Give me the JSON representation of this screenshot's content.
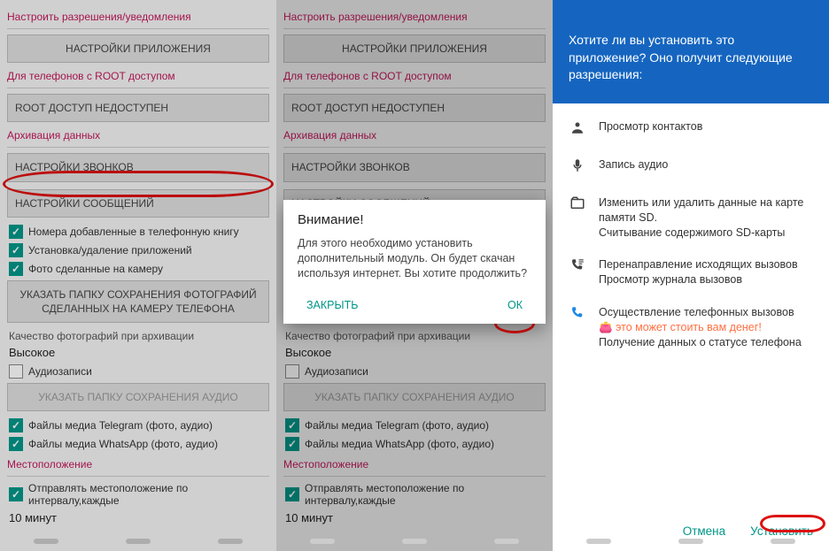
{
  "left": {
    "section_perm": "Настроить разрешения/уведомления",
    "btn_app_settings": "НАСТРОЙКИ ПРИЛОЖЕНИЯ",
    "section_root": "Для телефонов с ROOT доступом",
    "btn_root": "ROOT ДОСТУП НЕДОСТУПЕН",
    "section_archive": "Архивация данных",
    "btn_calls": "НАСТРОЙКИ ЗВОНКОВ",
    "btn_messages": "НАСТРОЙКИ СООБЩЕНИЙ",
    "check_contacts": "Номера добавленные в телефонную книгу",
    "check_apps": "Установка/удаление приложений",
    "check_photos": "Фото сделанные на камеру",
    "btn_photo_folder": "УКАЗАТЬ ПАПКУ СОХРАНЕНИЯ ФОТОГРАФИЙ СДЕЛАННЫХ НА КАМЕРУ ТЕЛЕФОНА",
    "label_quality": "Качество фотографий при архивации",
    "value_quality": "Высокое",
    "check_audio": "Аудиозаписи",
    "btn_audio_folder": "УКАЗАТЬ ПАПКУ СОХРАНЕНИЯ АУДИО",
    "check_telegram": "Файлы медиа Telegram (фото, аудио)",
    "check_whatsapp": "Файлы медиа WhatsApp (фото, аудио)",
    "section_location": "Местоположение",
    "check_location": "Отправлять местоположение по интервалу,каждые",
    "value_interval": "10 минут"
  },
  "dialog": {
    "title": "Внимание!",
    "body": "Для этого необходимо установить дополнительный модуль. Он будет скачан используя интернет. Вы хотите продолжить?",
    "close": "ЗАКРЫТЬ",
    "ok": "ОК"
  },
  "install": {
    "header": "Хотите ли вы установить это приложение? Оно получит следующие разрешения:",
    "perms": [
      {
        "text": "Просмотр контактов"
      },
      {
        "text": "Запись аудио"
      },
      {
        "text": "Изменить или удалить данные на карте памяти SD.\nСчитывание содержимого SD-карты"
      },
      {
        "text": "Перенаправление исходящих вызовов\nПросмотр журнала вызовов"
      },
      {
        "text": "Осуществление телефонных вызовов",
        "warn": "это может стоить вам денег!",
        "extra": "Получение данных о статусе телефона"
      }
    ],
    "cancel": "Отмена",
    "install_btn": "Установить"
  }
}
